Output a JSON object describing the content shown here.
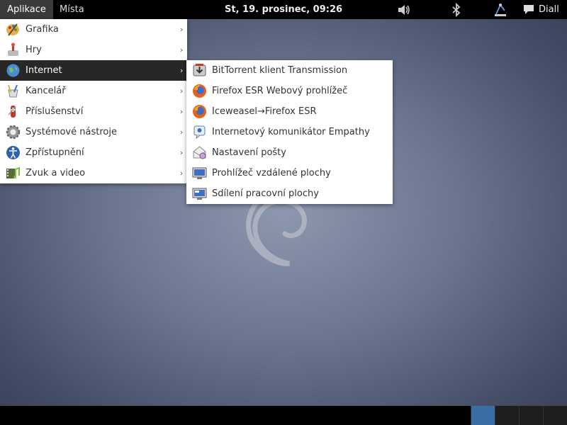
{
  "top_panel": {
    "applications_label": "Aplikace",
    "places_label": "Místa",
    "clock": "St, 19. prosinec, 09:26",
    "user_name": "Diall",
    "tray_icons": [
      "volume-icon",
      "bluetooth-icon",
      "network-icon",
      "chat-icon"
    ]
  },
  "app_menu": {
    "categories": [
      {
        "label": "Grafika",
        "icon": "graphics-icon"
      },
      {
        "label": "Hry",
        "icon": "games-icon"
      },
      {
        "label": "Internet",
        "icon": "internet-icon",
        "active": true
      },
      {
        "label": "Kancelář",
        "icon": "office-icon"
      },
      {
        "label": "Příslušenství",
        "icon": "accessories-icon"
      },
      {
        "label": "Systémové nástroje",
        "icon": "system-tools-icon"
      },
      {
        "label": "Zpřístupnění",
        "icon": "accessibility-icon"
      },
      {
        "label": "Zvuk a video",
        "icon": "sound-video-icon"
      }
    ]
  },
  "internet_submenu": {
    "items": [
      {
        "label": "BitTorrent klient Transmission",
        "icon": "transmission-icon"
      },
      {
        "label": "Firefox ESR Webový prohlížeč",
        "icon": "firefox-icon"
      },
      {
        "label": "Iceweasel→Firefox ESR",
        "icon": "firefox-icon"
      },
      {
        "label": "Internetový komunikátor Empathy",
        "icon": "empathy-icon"
      },
      {
        "label": "Nastavení pošty",
        "icon": "mail-settings-icon"
      },
      {
        "label": "Prohlížeč vzdálené plochy",
        "icon": "remote-desktop-icon"
      },
      {
        "label": "Sdílení pracovní plochy",
        "icon": "desktop-sharing-icon"
      }
    ]
  },
  "bottom_panel": {
    "workspaces": 4,
    "active_workspace": 1
  },
  "colors": {
    "panel": "#000000",
    "menu_bg": "#ffffff",
    "menu_active": "#272727",
    "workspace_active": "#3a6ea5"
  }
}
